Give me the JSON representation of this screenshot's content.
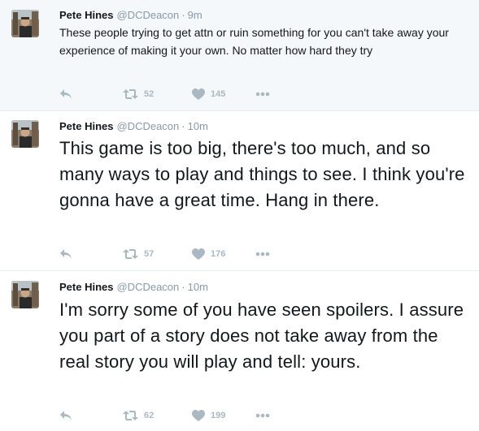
{
  "tweets": [
    {
      "name": "Pete Hines",
      "handle": "@DCDeacon",
      "time": "9m",
      "text": "These people trying to get attn or ruin something for you can't take away your experience of making it your own. No matter how hard they try",
      "retweets": "52",
      "likes": "145"
    },
    {
      "name": "Pete Hines",
      "handle": "@DCDeacon",
      "time": "10m",
      "text": "This game is too big, there's too much, and so many ways to play and things to see. I think you're gonna have a great time. Hang in there.",
      "retweets": "57",
      "likes": "176"
    },
    {
      "name": "Pete Hines",
      "handle": "@DCDeacon",
      "time": "10m",
      "text": "I'm sorry some of you have seen spoilers. I assure you part of a story does not take away from the real story you will play and tell: yours.",
      "retweets": "62",
      "likes": "199"
    }
  ],
  "separator": "·",
  "icons": {
    "reply": "reply-icon",
    "retweet": "retweet-icon",
    "like": "heart-icon",
    "more": "more-icon"
  },
  "colors": {
    "highlight_bg": "#f5f8fa",
    "muted": "#8899a6",
    "action": "#aab8c2",
    "divider": "#e6ecf0"
  }
}
